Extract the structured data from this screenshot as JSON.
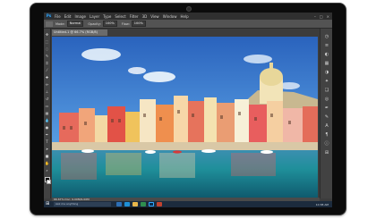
{
  "app": {
    "logo_text": "Ps"
  },
  "menubar": {
    "items": [
      "File",
      "Edit",
      "Image",
      "Layer",
      "Type",
      "Select",
      "Filter",
      "3D",
      "View",
      "Window",
      "Help"
    ],
    "window_controls": [
      "–",
      "□",
      "×"
    ]
  },
  "options_bar": {
    "mode_label": "Mode:",
    "mode_value": "Normal",
    "opacity_label": "Opacity:",
    "opacity_value": "100%",
    "flow_label": "Flow:",
    "flow_value": "100%"
  },
  "document": {
    "tab_title": "Untitled-1 @ 66.7% (RGB/8)",
    "status_text": "66.67%    Doc: 9.00M/9.00M"
  },
  "taskbar": {
    "search_placeholder": "Ask me anything",
    "clock": "10:38 AM"
  },
  "colors": {
    "sky_top": "#2f6fc4",
    "sky_bottom": "#79b6ec",
    "water": "#1f8fa0",
    "taskbar": "#1c2b3d"
  }
}
